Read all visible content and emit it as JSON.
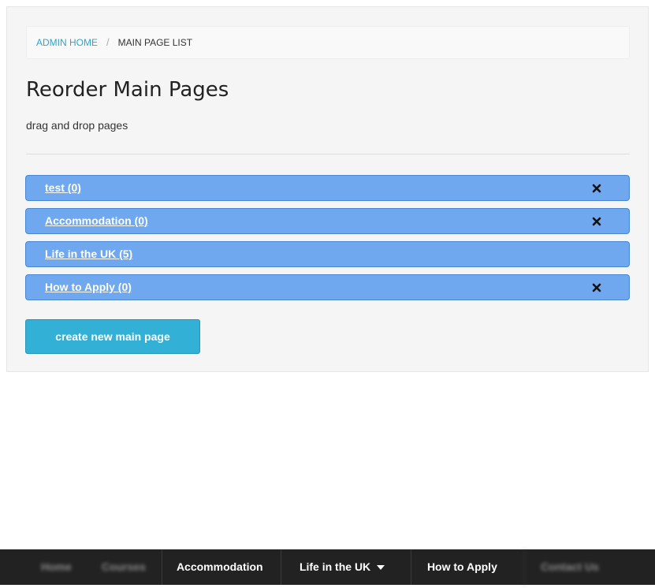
{
  "breadcrumb": {
    "home_label": "ADMIN HOME",
    "separator": "/",
    "current_label": "MAIN PAGE LIST"
  },
  "header": {
    "title": "Reorder Main Pages",
    "subtitle": "drag and drop pages"
  },
  "pages": [
    {
      "label": "test (0)",
      "deletable": true
    },
    {
      "label": "Accommodation (0)",
      "deletable": true
    },
    {
      "label": "Life in the UK (5)",
      "deletable": false
    },
    {
      "label": "How to Apply (0)",
      "deletable": true
    }
  ],
  "actions": {
    "create_label": "create new main page"
  },
  "nav": {
    "items": [
      {
        "label": "Home",
        "blurred": true
      },
      {
        "label": "Courses",
        "blurred": true
      },
      {
        "label": "Accommodation",
        "blurred": false
      },
      {
        "label": "Life in the UK",
        "blurred": false,
        "dropdown": true
      },
      {
        "label": "How to Apply",
        "blurred": false
      },
      {
        "label": "Contact Us",
        "blurred": true
      }
    ]
  },
  "colors": {
    "accent_link": "#2ba6cb",
    "page_item_bg": "#6fa8ee",
    "button_bg": "#32b0d6",
    "navbar_bg": "#222222"
  },
  "icons": {
    "delete": "close-icon",
    "dropdown": "caret-down-icon"
  }
}
